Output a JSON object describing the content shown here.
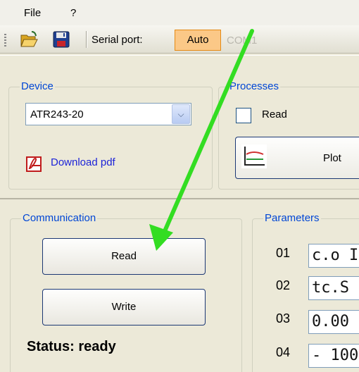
{
  "menu": {
    "file": "File",
    "help": "?"
  },
  "toolbar": {
    "open_icon": "folder-open-icon",
    "save_icon": "floppy-disk-icon",
    "serial_label": "Serial port:",
    "auto_label": "Auto",
    "com_port": "COM1"
  },
  "device": {
    "title": "Device",
    "selected": "ATR243-20",
    "download_label": "Download pdf",
    "download_icon": "pdf-icon"
  },
  "processes": {
    "title": "Processes",
    "read_checkbox_label": "Read",
    "read_checked": false,
    "plot_label": "Plot",
    "plot_icon": "chart-icon"
  },
  "communication": {
    "title": "Communication",
    "read_label": "Read",
    "write_label": "Write",
    "status_text": "Status: ready"
  },
  "parameters": {
    "title": "Parameters",
    "items": [
      {
        "num": "01",
        "value": "c.o I"
      },
      {
        "num": "02",
        "value": "tc.S"
      },
      {
        "num": "03",
        "value": "0.00"
      },
      {
        "num": "04",
        "value": "- 100"
      }
    ]
  },
  "colors": {
    "window_bg": "#ece9d8",
    "group_title": "#0046d5",
    "auto_button": "#fbc887",
    "link": "#1c23d8",
    "annotation_arrow": "#33dd22"
  }
}
